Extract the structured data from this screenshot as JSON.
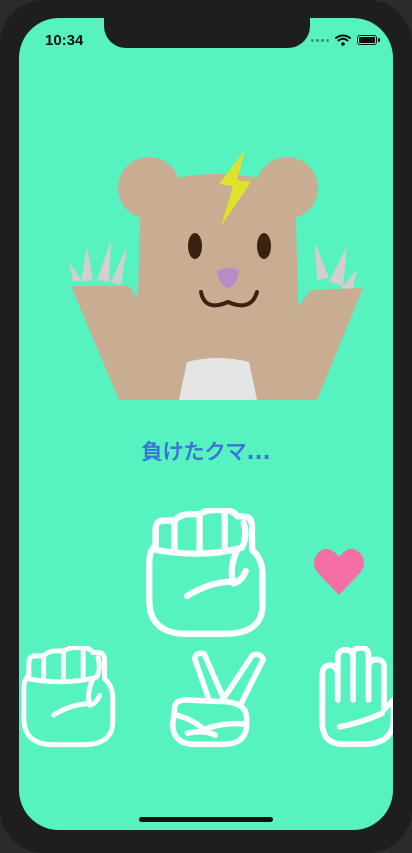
{
  "status_bar": {
    "time": "10:34"
  },
  "result": {
    "message": "負けたクマ..."
  },
  "colors": {
    "background": "#56f2c0",
    "bear_fur": "#c9ad92",
    "lightning": "#dfe12a",
    "result_text": "#3a73d8",
    "heart": "#f56fa6",
    "hand_outline": "#ffffff"
  },
  "icons": {
    "opponent_hand": "rock-hand-icon",
    "life": "heart-icon",
    "choices": [
      "rock-hand-icon",
      "scissors-hand-icon",
      "paper-hand-icon"
    ]
  }
}
